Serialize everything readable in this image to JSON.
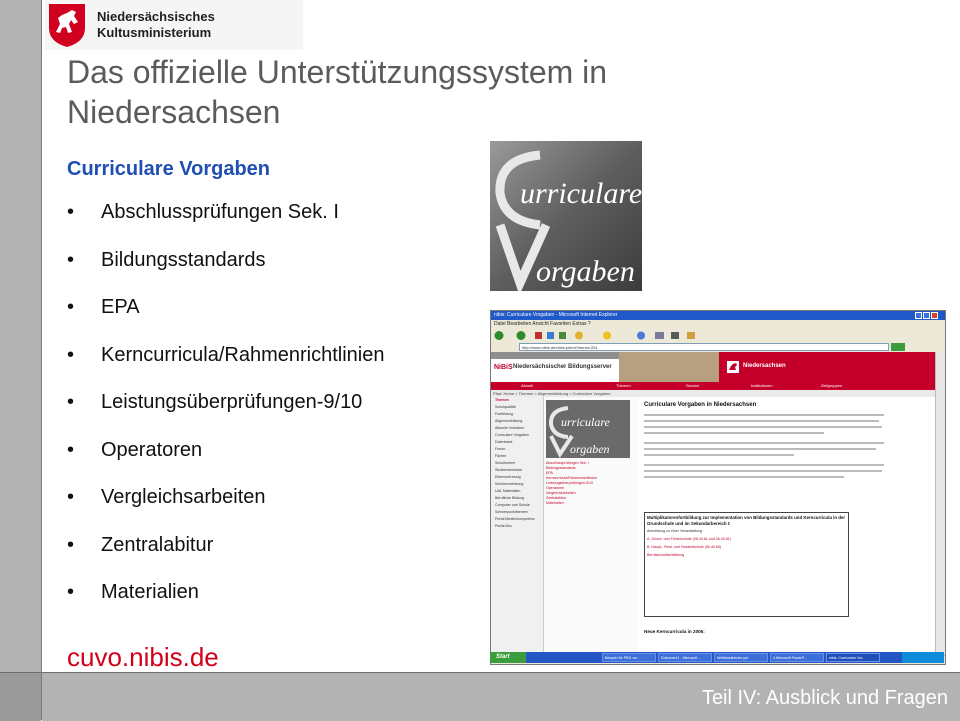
{
  "logo": {
    "line1": "Niedersächsisches",
    "line2": "Kultusministerium"
  },
  "slide": {
    "title": "Das offizielle Unterstützungssystem in Niedersachsen",
    "subtitle": "Curriculare Vorgaben",
    "bullet_char": "•",
    "bullets": [
      "Abschlussprüfungen Sek. I",
      "Bildungsstandards",
      "EPA",
      "Kerncurricula/Rahmenrichtlinien",
      "Leistungsüberprüfungen-9/10",
      "Operatoren",
      "Vergleichsarbeiten",
      "Zentralabitur",
      "Materialien"
    ],
    "link": "cuvo.nibis.de",
    "footer": "Teil IV: Ausblick und Fragen"
  },
  "image_logo": {
    "line1": "urriculare",
    "line2": "orgaben"
  },
  "browser": {
    "window_title": "nibis: Curriculare Vorgaben - Microsoft Internet Explorer",
    "menu": "Datei   Bearbeiten   Ansicht   Favoriten   Extras   ?",
    "address": "http://www.nibis.de/nibis.phtml?menid=251",
    "banner_nibis": "NiBiS",
    "banner_server": "Niedersächsischer Bildungsserver",
    "banner_state": "Niedersachsen",
    "nav": [
      "Aktuell",
      "Themen",
      "Service",
      "Institutionen",
      "Zielgruppen"
    ],
    "breadcrumb": "Pfad: Home > Themen > Allgemeinbildung > Curriculare Vorgaben",
    "sidebar_head": "Themen",
    "sidebar": [
      "Schulqualität",
      "Fortbildung",
      "Allgemeinbildung",
      "Aktuelle Vorhaben",
      "Curriculare Vorgaben",
      "Datenbank",
      "Forum",
      "Fächer",
      "Schulformen",
      "Studienseminare",
      "Elternvertretung",
      "Schülervertretung",
      "UAL Materialien",
      "Berufliche Bildung",
      "Computer und Schule",
      "Schwerpunktthemen",
      "Portal Medienkompetenz",
      "Portal Abu"
    ],
    "mid_links": [
      "Abschlussprüfungen Sek. I",
      "Bildungsstandards",
      "EPA",
      "Kerncurricula/Rahmenrichtlinien",
      "Leistungsüberprüfungen-9/10",
      "Operatoren",
      "Vergleichsarbeiten",
      "Zentralabitur",
      "Materialien"
    ],
    "content_title": "Curriculare Vorgaben in Niedersachsen",
    "box_title": "Multiplikatorenfortbildung zur Implementation von Bildungsstandards und Kerncurricula in der Grundschule und im Sekundarbereich I:",
    "box_line1": "Anmeldung zu einer Veranstaltung",
    "box_line2": "A. Grund- und Förderschule (08.44.61 und 06.40.61)",
    "box_line3": "B. Haupt-, Real- und Gesamtschule (06.40.65)",
    "box_line4": "Berufsschulfachbildung",
    "new_head": "Neue Kerncurricula in 2006:",
    "status": "Internet",
    "start": "Start",
    "tasks": [
      "Beispiel für PBG zur ...",
      "Dokument1 - Microsoft ...",
      "Weitblaskbinder.ppt",
      "4 Microsoft PowerP...",
      "nibis: Curriculare Vor..."
    ]
  }
}
